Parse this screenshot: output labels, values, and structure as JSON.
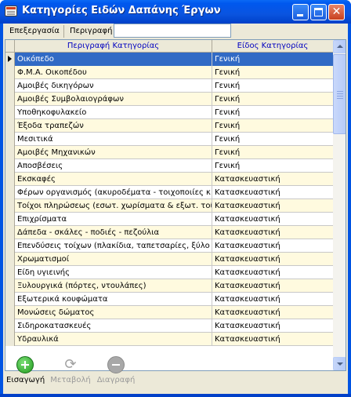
{
  "window": {
    "title": "Κατηγορίες Ειδών Δαπάνης Έργων",
    "minimize_icon": "minimize-icon",
    "maximize_icon": "maximize-icon",
    "close_glyph": "✕"
  },
  "filterbar": {
    "edit_label": "Επεξεργασία",
    "search_label": "Περιγραφή",
    "search_value": ""
  },
  "grid": {
    "columns": [
      "Περιγραφή Κατηγορίας",
      "Είδος Κατηγορίας"
    ],
    "selected_index": 0,
    "rows": [
      {
        "desc": "Οικόπεδο",
        "type": "Γενική"
      },
      {
        "desc": "Φ.Μ.Α. Οικοπέδου",
        "type": "Γενική"
      },
      {
        "desc": "Αμοιβές δικηγόρων",
        "type": "Γενική"
      },
      {
        "desc": "Αμοιβές Συμβολαιογράφων",
        "type": "Γενική"
      },
      {
        "desc": "Υποθηκοφυλακείο",
        "type": "Γενική"
      },
      {
        "desc": "Έξοδα τραπεζών",
        "type": "Γενική"
      },
      {
        "desc": "Μεσιτικά",
        "type": "Γενική"
      },
      {
        "desc": "Αμοιβές Μηχανικών",
        "type": "Γενική"
      },
      {
        "desc": "Αποσβέσεις",
        "type": "Γενική"
      },
      {
        "desc": "Εκσκαφές",
        "type": "Κατασκευαστική"
      },
      {
        "desc": "Φέρων οργανισμός (ακυροδέματα - τοιχοποιίες κ.λ.π",
        "type": "Κατασκευαστική"
      },
      {
        "desc": "Τοίχοι πληρώσεως (εσωτ. χωρίσματα & εξωτ. τοίχοι)",
        "type": "Κατασκευαστική"
      },
      {
        "desc": "Επιχρίσματα",
        "type": "Κατασκευαστική"
      },
      {
        "desc": "Δάπεδα - σκάλες - ποδιές - πεζούλια",
        "type": "Κατασκευαστική"
      },
      {
        "desc": "Επενδύσεις τοίχων (πλακίδια, ταπετσαρίες, ξύλο κ.λ.",
        "type": "Κατασκευαστική"
      },
      {
        "desc": "Χρωματισμοί",
        "type": "Κατασκευαστική"
      },
      {
        "desc": "Είδη υγιεινής",
        "type": "Κατασκευαστική"
      },
      {
        "desc": "Ξυλουργικά (πόρτες, ντουλάπες)",
        "type": "Κατασκευαστική"
      },
      {
        "desc": "Εξωτερικά κουφώματα",
        "type": "Κατασκευαστική"
      },
      {
        "desc": "Μονώσεις δώματος",
        "type": "Κατασκευαστική"
      },
      {
        "desc": "Σιδηροκατασκευές",
        "type": "Κατασκευαστική"
      },
      {
        "desc": "Υδραυλικά",
        "type": "Κατασκευαστική"
      }
    ]
  },
  "toolbar": {
    "add_label": "Εισαγωγή",
    "modify_label": "Μεταβολή",
    "delete_label": "Διαγραφή",
    "add_icon": "add-icon",
    "modify_icon": "refresh-icon",
    "delete_icon": "remove-icon",
    "refresh_glyph": "⟳"
  },
  "colors": {
    "titlebar": "#0058ee",
    "selection": "#316ac5",
    "row_alt": "#fffadf",
    "header_text": "#0000c0",
    "add_green": "#1f9a1a",
    "disabled_text": "#9a9a9a"
  }
}
